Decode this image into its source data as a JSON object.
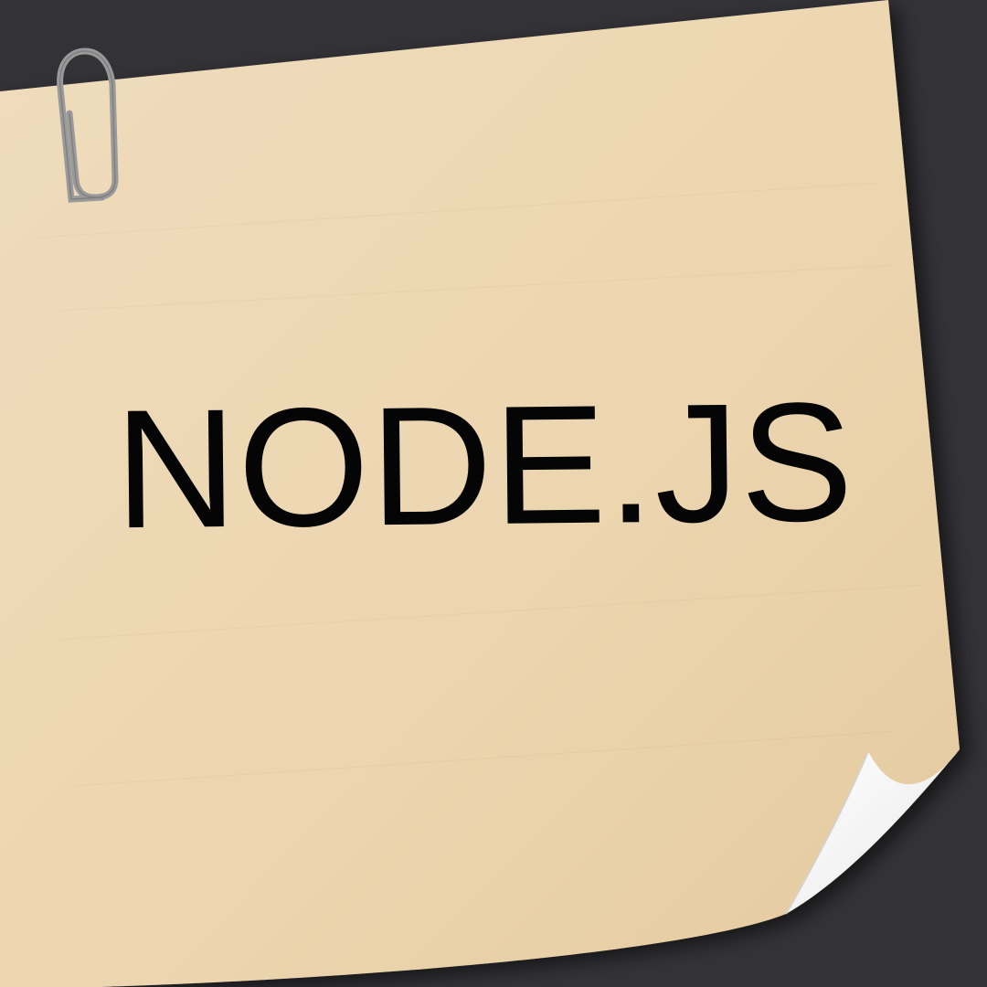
{
  "note": {
    "title": "NODE.JS"
  },
  "colors": {
    "background": "#333237",
    "paper": "#ecd6b0",
    "text": "#050505",
    "clip": "#8d8d8d",
    "curl": "#f7f7f7"
  },
  "icons": {
    "clip": "paperclip-icon"
  }
}
